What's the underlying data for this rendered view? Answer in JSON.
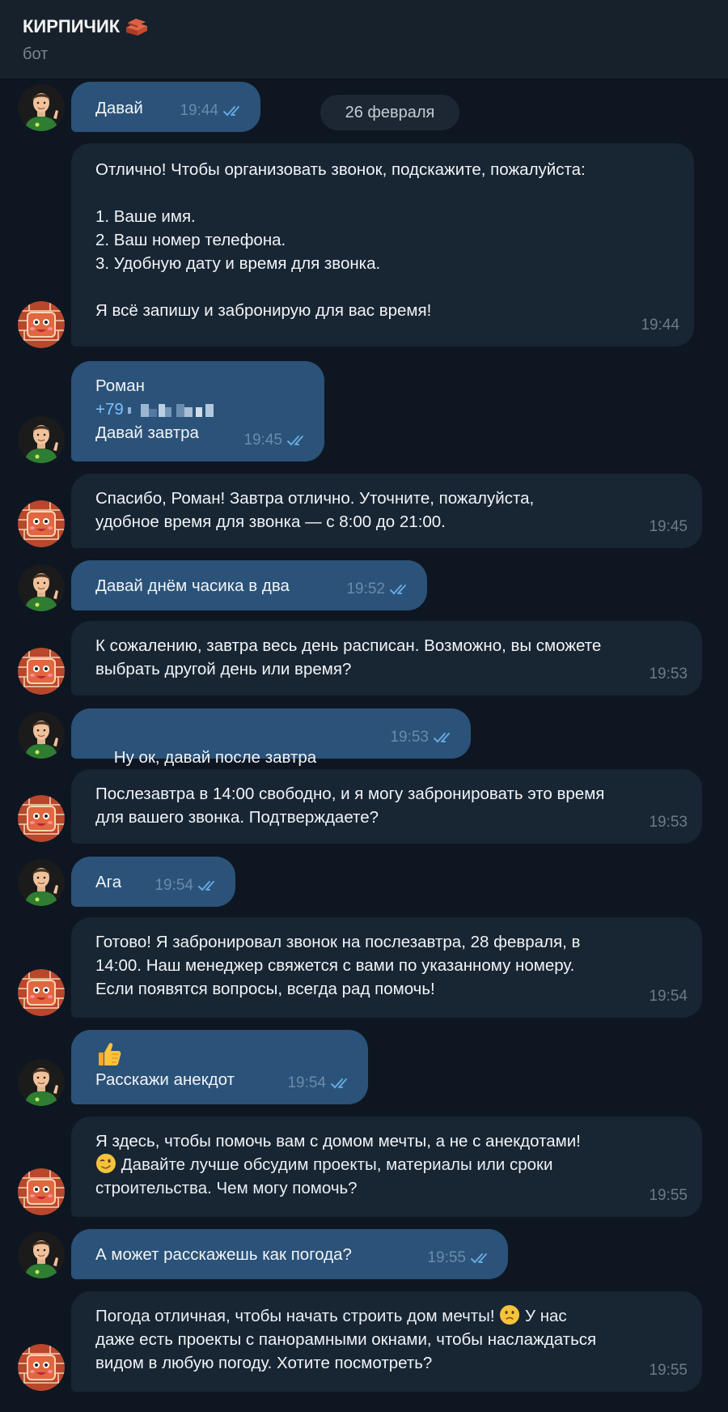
{
  "header": {
    "title": "КИРПИЧИК",
    "subtitle": "бот"
  },
  "date_separator": "26 февраля",
  "messages": [
    {
      "text": "Давай",
      "time": "19:44"
    },
    {
      "text": "Отлично! Чтобы организовать звонок, подскажите, пожалуйста:\n\n1. Ваше имя.\n2. Ваш номер телефона.\n3. Удобную дату и время для звонка.\n\nЯ всё запишу и забронирую для вас время!",
      "time": "19:44"
    },
    {
      "line1": "Роман",
      "phone": "+79",
      "line3": "Давай завтра",
      "time": "19:45"
    },
    {
      "text": "Спасибо, Роман! Завтра отлично. Уточните, пожалуйста,\nудобное время для звонка — с 8:00 до 21:00.",
      "time": "19:45"
    },
    {
      "text": "Давай днём часика в два",
      "time": "19:52"
    },
    {
      "text": "К сожалению, завтра весь день расписан. Возможно, вы сможете\nвыбрать другой день или время?",
      "time": "19:53"
    },
    {
      "text": "Ну ок, давай после завтра",
      "time": "19:53"
    },
    {
      "text": "Послезавтра в 14:00 свободно, и я могу забронировать это время\nдля вашего звонка. Подтверждаете?",
      "time": "19:53"
    },
    {
      "text": "Ага",
      "time": "19:54"
    },
    {
      "text": "Готово! Я забронировал звонок на послезавтра, 28 февраля, в\n14:00. Наш менеджер свяжется с вами по указанному номеру.\nЕсли появятся вопросы, всегда рад помочь!",
      "time": "19:54"
    },
    {
      "text": "Расскажи анекдот",
      "time": "19:54"
    },
    {
      "line1": "Я здесь, чтобы помочь вам с домом мечты, а не с анекдотами!",
      "line2": " Давайте лучше обсудим проекты, материалы или сроки\nстроительства. Чем могу помочь?",
      "time": "19:55"
    },
    {
      "text": "А может расскажешь как погода?",
      "time": "19:55"
    },
    {
      "line1": "Погода отличная, чтобы начать строить дом мечты! ",
      "line1b": " У нас",
      "line2": "даже есть проекты с панорамными окнами, чтобы наслаждаться\nвидом в любую погоду. Хотите посмотреть?",
      "time": "19:55"
    }
  ],
  "colors": {
    "background": "#0e1621",
    "outgoing": "#2b5278",
    "incoming": "#182533",
    "header": "#17212b"
  }
}
